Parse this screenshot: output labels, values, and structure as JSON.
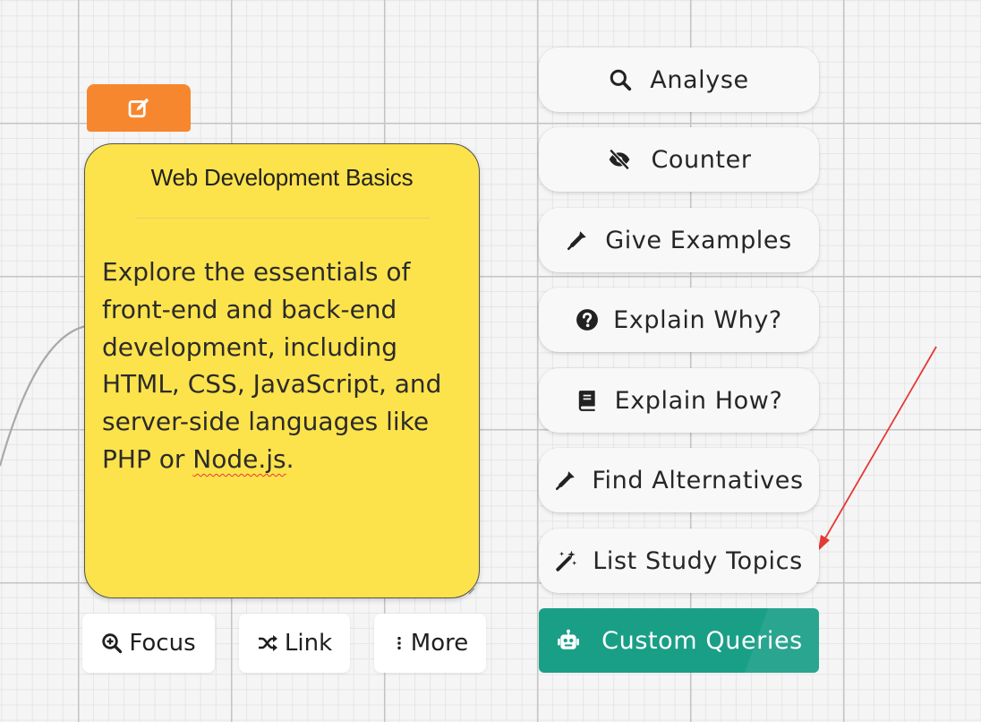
{
  "note": {
    "title": "Web Development Basics",
    "body_lines": [
      "Explore the essentials of",
      "front-end and back-end",
      "development, including",
      "HTML, CSS, JavaScript, and",
      "server-side languages like"
    ],
    "last_line_prefix": "PHP or ",
    "last_line_flagged_word": "Node.js",
    "last_line_suffix": ".",
    "background_color": "#fde34b"
  },
  "edit_tab": {
    "icon": "edit-icon",
    "color": "#f7872e"
  },
  "bottom_actions": [
    {
      "label": "Focus",
      "icon": "zoom-in-icon"
    },
    {
      "label": "Link",
      "icon": "shuffle-icon"
    },
    {
      "label": "More",
      "icon": "vertical-dots-icon"
    }
  ],
  "side_menu": [
    {
      "label": "Analyse",
      "icon": "search-icon"
    },
    {
      "label": "Counter",
      "icon": "eye-slash-icon"
    },
    {
      "label": "Give Examples",
      "icon": "eyedropper-icon"
    },
    {
      "label": "Explain Why?",
      "icon": "question-circle-icon"
    },
    {
      "label": "Explain How?",
      "icon": "book-icon"
    },
    {
      "label": "Find Alternatives",
      "icon": "eyedropper-icon"
    },
    {
      "label": "List Study Topics",
      "icon": "magic-wand-icon"
    },
    {
      "label": "Custom Queries",
      "icon": "robot-icon",
      "primary": true,
      "color": "#1a9f87"
    }
  ],
  "annotation": {
    "arrow_color": "#e53935"
  }
}
